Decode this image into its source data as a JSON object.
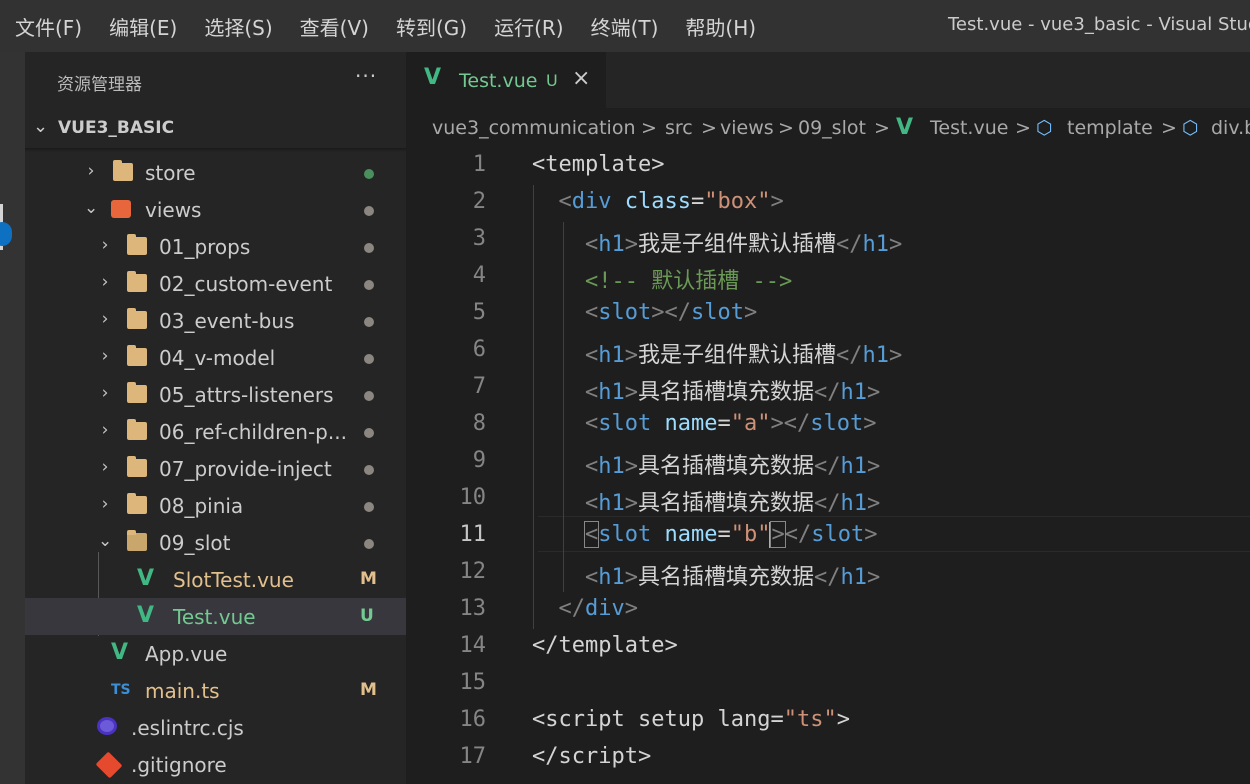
{
  "menu": [
    {
      "label": "文件(F)"
    },
    {
      "label": "编辑(E)"
    },
    {
      "label": "选择(S)"
    },
    {
      "label": "查看(V)"
    },
    {
      "label": "转到(G)"
    },
    {
      "label": "运行(R)"
    },
    {
      "label": "终端(T)"
    },
    {
      "label": "帮助(H)"
    }
  ],
  "window_title": "Test.vue - vue3_basic - Visual Studio",
  "activity": {
    "badge": "0"
  },
  "explorer": {
    "title": "资源管理器",
    "more": "···",
    "root": "VUE3_BASIC",
    "items": [
      {
        "name": "store",
        "kind": "folder",
        "status": "dot-green"
      },
      {
        "name": "views",
        "kind": "folder-special",
        "status": "dot"
      },
      {
        "name": "01_props",
        "kind": "folder",
        "status": "dot"
      },
      {
        "name": "02_custom-event",
        "kind": "folder",
        "status": "dot"
      },
      {
        "name": "03_event-bus",
        "kind": "folder",
        "status": "dot"
      },
      {
        "name": "04_v-model",
        "kind": "folder",
        "status": "dot"
      },
      {
        "name": "05_attrs-listeners",
        "kind": "folder",
        "status": "dot"
      },
      {
        "name": "06_ref-children-p...",
        "kind": "folder",
        "status": "dot"
      },
      {
        "name": "07_provide-inject",
        "kind": "folder",
        "status": "dot"
      },
      {
        "name": "08_pinia",
        "kind": "folder",
        "status": "dot"
      },
      {
        "name": "09_slot",
        "kind": "folder-open",
        "status": "dot"
      },
      {
        "name": "SlotTest.vue",
        "kind": "vue",
        "status": "M"
      },
      {
        "name": "Test.vue",
        "kind": "vue",
        "status": "U"
      },
      {
        "name": "App.vue",
        "kind": "vue",
        "status": ""
      },
      {
        "name": "main.ts",
        "kind": "ts",
        "status": "M"
      },
      {
        "name": ".eslintrc.cjs",
        "kind": "eslint",
        "status": ""
      },
      {
        "name": ".gitignore",
        "kind": "git",
        "status": ""
      }
    ]
  },
  "tab": {
    "name": "Test.vue",
    "status": "U",
    "close": "×"
  },
  "breadcrumb": {
    "parts": [
      "vue3_communication",
      "src",
      "views",
      "09_slot",
      "Test.vue",
      "template",
      "div.b"
    ],
    "sep": ">"
  },
  "code": {
    "lines": [
      "1",
      "2",
      "3",
      "4",
      "5",
      "6",
      "7",
      "8",
      "9",
      "10",
      "11",
      "12",
      "13",
      "14",
      "15",
      "16",
      "17"
    ],
    "current_line": "11",
    "text": {
      "template_open": "template",
      "div": "div",
      "class_attr": "class",
      "box": "\"box\"",
      "h1": "h1",
      "default_slot_text": "我是子组件默认插槽",
      "comment": "<!-- 默认插槽 -->",
      "slot": "slot",
      "named_text": "具名插槽填充数据",
      "name_attr": "name",
      "a": "\"a\"",
      "b": "\"b",
      "b_close": "\"",
      "script": "script",
      "setup": "setup",
      "lang": "lang",
      "ts": "\"ts\""
    }
  },
  "colors": {
    "accent": "#0e70c0",
    "vue_green": "#41b883",
    "untracked": "#73c991",
    "modified": "#e2c08d"
  }
}
